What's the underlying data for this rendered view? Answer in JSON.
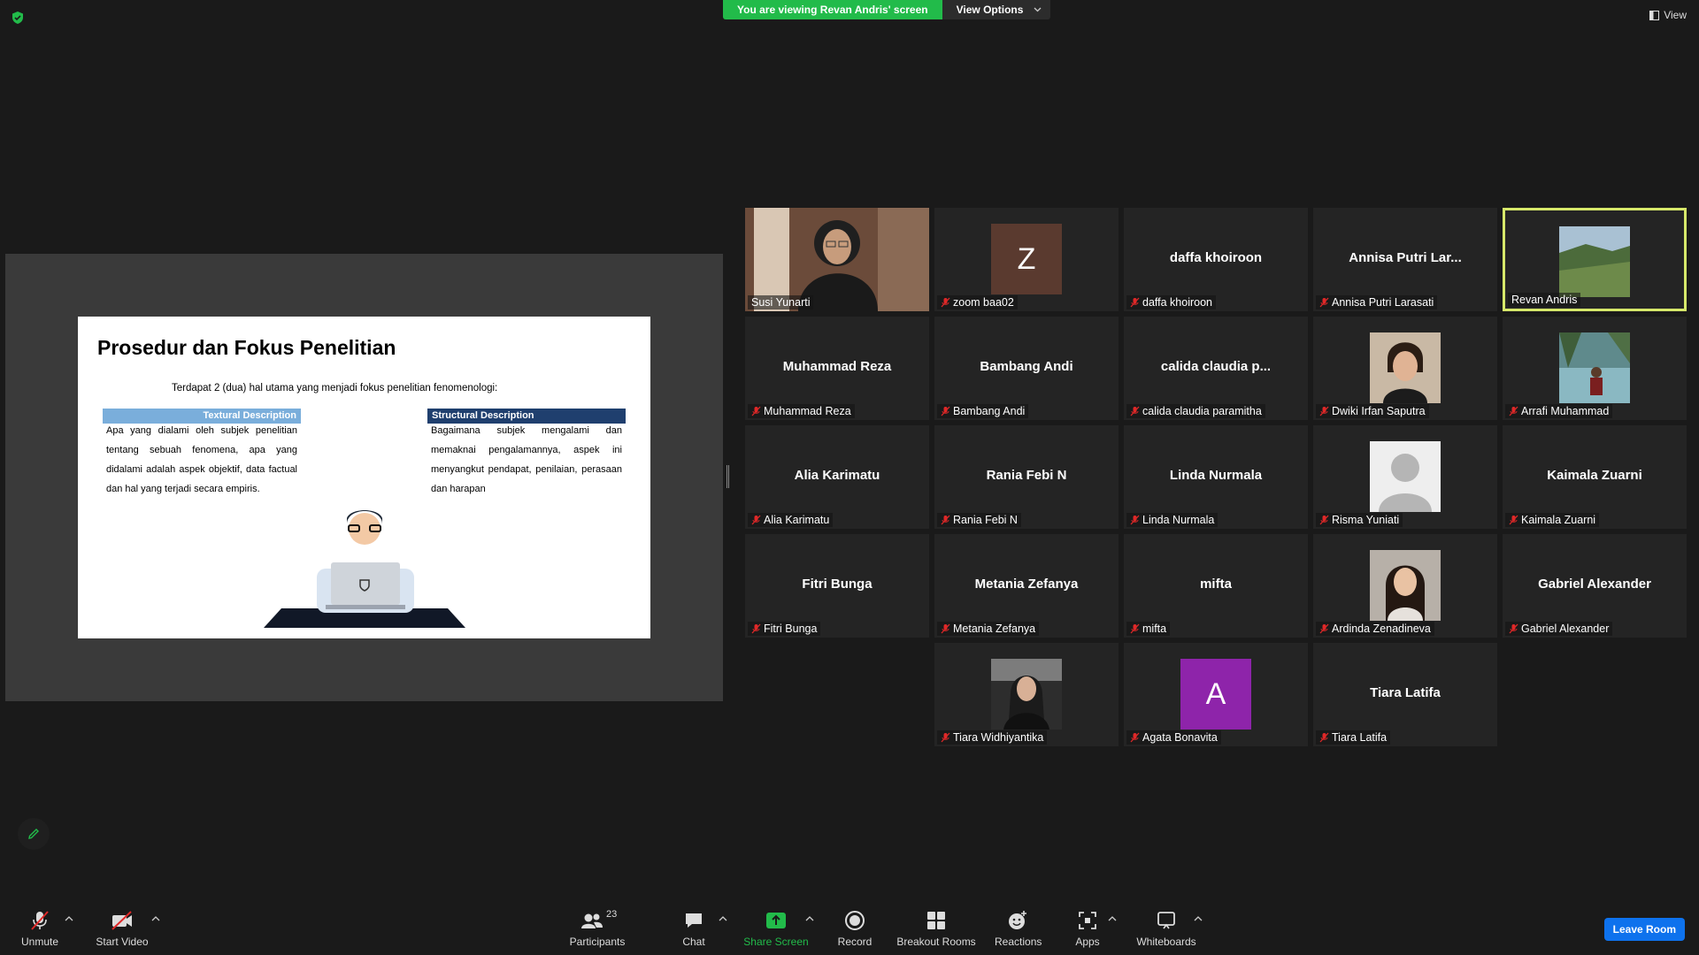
{
  "topbar": {
    "viewing_label": "You are viewing Revan Andris' screen",
    "view_options_label": "View Options",
    "view_label": "View"
  },
  "slide": {
    "title": "Prosedur dan Fokus Penelitian",
    "intro": "Terdapat 2 (dua) hal utama yang menjadi fokus penelitian fenomenologi:",
    "left_heading": "Textural Description",
    "left_text": "Apa yang dialami oleh subjek penelitian tentang sebuah fenomena, apa yang didalami adalah aspek objektif, data factual dan hal yang terjadi secara empiris.",
    "right_heading": "Structural Description",
    "right_text": "Bagaimana subjek mengalami dan memaknai pengalamannya, aspek ini menyangkut pendapat, penilaian, perasaan dan harapan"
  },
  "participants": [
    {
      "name": "Susi Yunarti",
      "big": "",
      "muted": false,
      "media": "photo-woman"
    },
    {
      "name": "zoom baa02",
      "big": "",
      "muted": true,
      "media": "letter-Z"
    },
    {
      "name": "daffa khoiroon",
      "big": "daffa khoiroon",
      "muted": true,
      "media": ""
    },
    {
      "name": "Annisa Putri Larasati",
      "big": "Annisa Putri Lar...",
      "muted": true,
      "media": ""
    },
    {
      "name": "Revan Andris",
      "big": "",
      "muted": false,
      "media": "photo-landscape"
    },
    {
      "name": "Muhammad Reza",
      "big": "Muhammad Reza",
      "muted": true,
      "media": ""
    },
    {
      "name": "Bambang Andi",
      "big": "Bambang Andi",
      "muted": true,
      "media": ""
    },
    {
      "name": "calida claudia paramitha",
      "big": "calida claudia p...",
      "muted": true,
      "media": ""
    },
    {
      "name": "Dwiki Irfan Saputra",
      "big": "",
      "muted": true,
      "media": "photo-man"
    },
    {
      "name": "Arrafi Muhammad",
      "big": "",
      "muted": true,
      "media": "photo-lake"
    },
    {
      "name": "Alia Karimatu",
      "big": "Alia Karimatu",
      "muted": true,
      "media": ""
    },
    {
      "name": "Rania Febi N",
      "big": "Rania Febi N",
      "muted": true,
      "media": ""
    },
    {
      "name": "Linda Nurmala",
      "big": "Linda Nurmala",
      "muted": true,
      "media": ""
    },
    {
      "name": "Risma Yuniati",
      "big": "",
      "muted": true,
      "media": "default-avatar"
    },
    {
      "name": "Kaimala Zuarni",
      "big": "Kaimala Zuarni",
      "muted": true,
      "media": ""
    },
    {
      "name": "Fitri Bunga",
      "big": "Fitri Bunga",
      "muted": true,
      "media": ""
    },
    {
      "name": "Metania Zefanya",
      "big": "Metania Zefanya",
      "muted": true,
      "media": ""
    },
    {
      "name": "mifta",
      "big": "mifta",
      "muted": true,
      "media": ""
    },
    {
      "name": "Ardinda Zenadineva",
      "big": "",
      "muted": true,
      "media": "photo-girl"
    },
    {
      "name": "Gabriel Alexander",
      "big": "Gabriel Alexander",
      "muted": true,
      "media": ""
    },
    {
      "name": "Tiara Widhiyantika",
      "big": "",
      "muted": true,
      "media": "photo-woman-dark"
    },
    {
      "name": "Agata Bonavita",
      "big": "",
      "muted": true,
      "media": "letter-A"
    },
    {
      "name": "Tiara Latifa",
      "big": "Tiara Latifa",
      "muted": true,
      "media": ""
    }
  ],
  "letters": {
    "Z": "Z",
    "A": "A"
  },
  "colors": {
    "letter_Z": "#5a3a2f",
    "letter_A": "#8e24aa",
    "active_border": "#d6e86a",
    "viewing_green": "#22bb4a",
    "leave_blue": "#0e72ed"
  },
  "toolbar": {
    "unmute": "Unmute",
    "start_video": "Start Video",
    "participants": "Participants",
    "participants_count": "23",
    "chat": "Chat",
    "share_screen": "Share Screen",
    "record": "Record",
    "breakout_rooms": "Breakout Rooms",
    "reactions": "Reactions",
    "apps": "Apps",
    "whiteboards": "Whiteboards",
    "leave": "Leave Room"
  }
}
